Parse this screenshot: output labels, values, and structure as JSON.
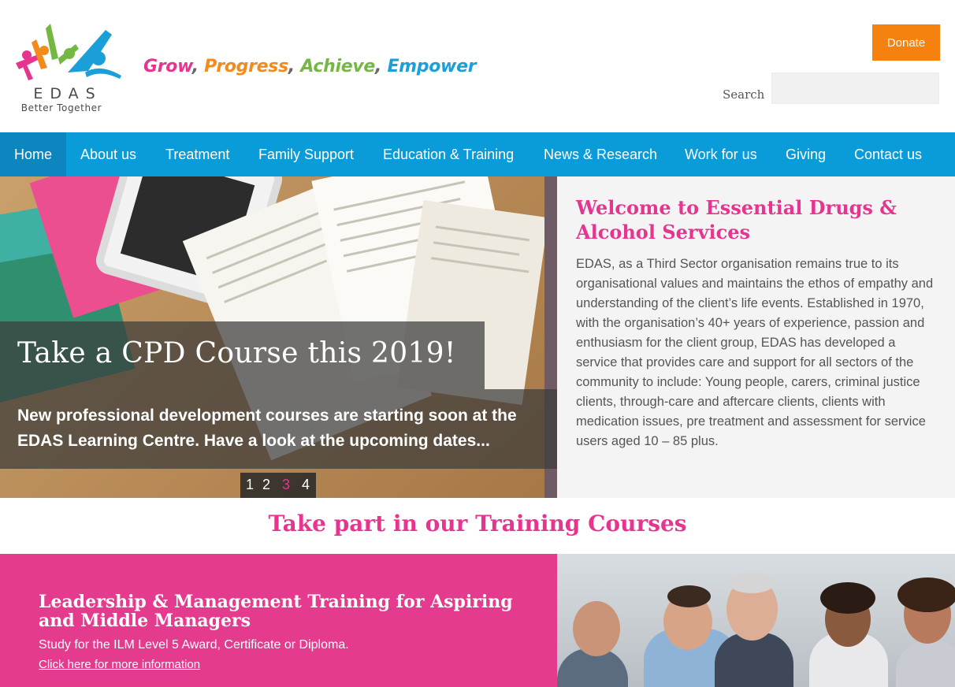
{
  "brand": {
    "name": "EDAS",
    "tagline": "Better Together",
    "logo_colors": [
      "#e5358f",
      "#f28a1c",
      "#74b843",
      "#1a9fd8"
    ]
  },
  "slogan": {
    "w1": "Grow",
    "w2": "Progress",
    "w3": "Achieve",
    "w4": "Empower",
    "sep": ", "
  },
  "header": {
    "donate_label": "Donate",
    "search_label": "Search",
    "search_value": ""
  },
  "nav": [
    {
      "label": "Home",
      "active": true
    },
    {
      "label": "About us"
    },
    {
      "label": "Treatment"
    },
    {
      "label": "Family Support"
    },
    {
      "label": "Education & Training"
    },
    {
      "label": "News & Research"
    },
    {
      "label": "Work for us"
    },
    {
      "label": "Giving"
    },
    {
      "label": "Contact us"
    }
  ],
  "hero": {
    "title": "Take a CPD Course this 2019!",
    "body": "New professional development courses are starting soon at the EDAS Learning Centre. Have a look at the upcoming dates...",
    "pager": [
      "1",
      "2",
      "3",
      "4"
    ],
    "current_slide": "3"
  },
  "welcome": {
    "title": "Welcome to Essential Drugs & Alcohol Services",
    "text": "EDAS, as a Third Sector organisation remains true to its organisational values and maintains the ethos of empathy and understanding of the client’s life events. Established in 1970, with the organisation’s 40+ years of experience, passion and enthusiasm for the client group, EDAS has developed a service that provides care and support for all sectors of the community to include: Young people, carers, criminal justice clients, through-care and aftercare clients, clients with medication issues, pre treatment and assessment for service users aged 10 – 85 plus."
  },
  "training": {
    "heading": "Take part in our Training Courses",
    "course_title": "Leadership & Management Training for Aspiring and Middle Managers",
    "course_desc": "Study for the ILM Level 5 Award, Certificate or Diploma.",
    "course_link": "Click here for more information"
  },
  "colors": {
    "nav_bg": "#0a9bd9",
    "nav_active": "#0d86c0",
    "accent_pink": "#e5358f",
    "donate": "#f5810f",
    "panel_bg": "#f4f4f4"
  }
}
